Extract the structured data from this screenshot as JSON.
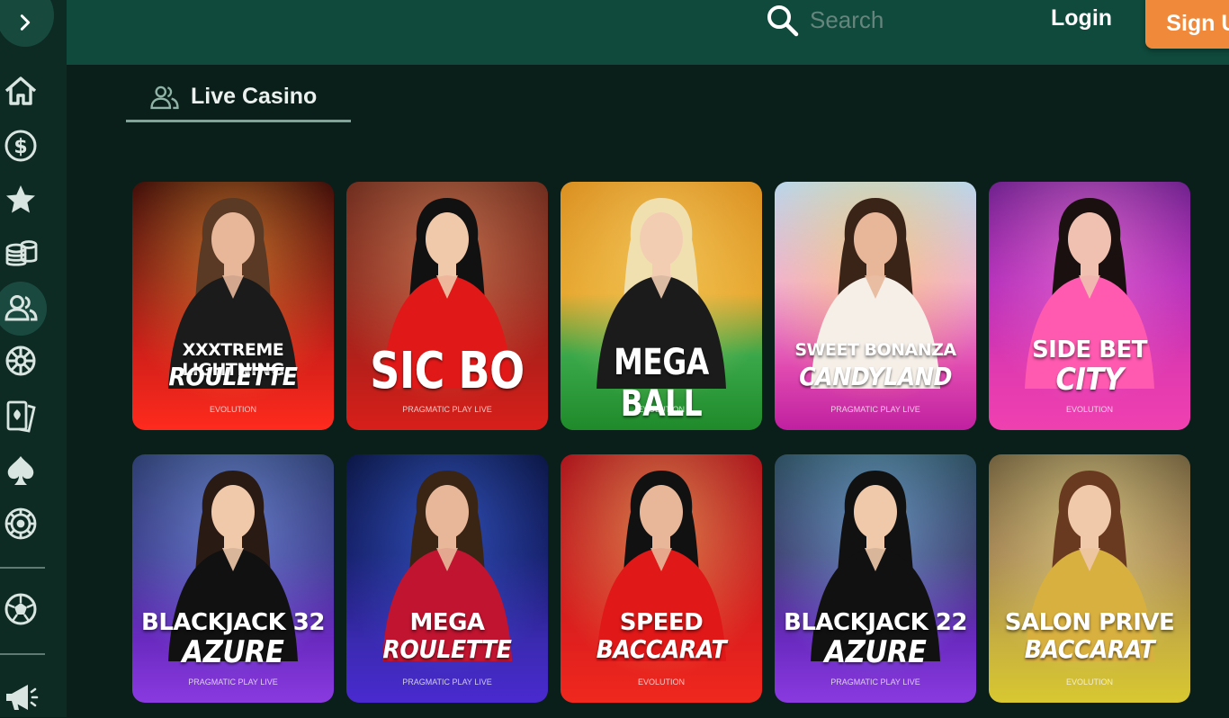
{
  "header": {
    "search_placeholder": "Search",
    "login_label": "Login",
    "signup_label": "Sign Up"
  },
  "sidebar": {
    "items": [
      {
        "icon": "home-icon"
      },
      {
        "icon": "dollar-icon"
      },
      {
        "icon": "star-icon"
      },
      {
        "icon": "coins-icon"
      },
      {
        "icon": "live-casino-icon",
        "active": true
      },
      {
        "icon": "wheel-icon"
      },
      {
        "icon": "cards-icon"
      },
      {
        "icon": "spade-icon"
      },
      {
        "icon": "roulette-icon"
      },
      {
        "icon": "soccer-ball-icon"
      },
      {
        "icon": "megaphone-icon"
      }
    ]
  },
  "section": {
    "title": "Live Casino"
  },
  "games": [
    {
      "line1": "XXXTREME LIGHTNING",
      "line2": "ROULETTE",
      "provider": "EVOLUTION",
      "theme": "red"
    },
    {
      "line1": "SIC BO",
      "line2": "",
      "provider": "PRAGMATIC PLAY LIVE",
      "theme": "crimson"
    },
    {
      "line1": "MEGA BALL",
      "line2": "",
      "provider": "EVOLUTION",
      "theme": "greengold"
    },
    {
      "line1": "SWEET BONANZA",
      "line2": "CANDYLAND",
      "provider": "PRAGMATIC PLAY LIVE",
      "theme": "pink"
    },
    {
      "line1": "SIDE BET",
      "line2": "CITY",
      "provider": "EVOLUTION",
      "theme": "magenta"
    },
    {
      "line1": "BLACKJACK 32",
      "line2": "AZURE",
      "provider": "PRAGMATIC PLAY LIVE",
      "theme": "purple"
    },
    {
      "line1": "MEGA",
      "line2": "ROULETTE",
      "provider": "PRAGMATIC PLAY LIVE",
      "theme": "navy"
    },
    {
      "line1": "SPEED",
      "line2": "BACCARAT",
      "provider": "EVOLUTION",
      "theme": "scarlet"
    },
    {
      "line1": "BLACKJACK 22",
      "line2": "AZURE",
      "provider": "PRAGMATIC PLAY LIVE",
      "theme": "violet"
    },
    {
      "line1": "SALON PRIVE",
      "line2": "BACCARAT",
      "provider": "EVOLUTION",
      "theme": "gold"
    }
  ]
}
